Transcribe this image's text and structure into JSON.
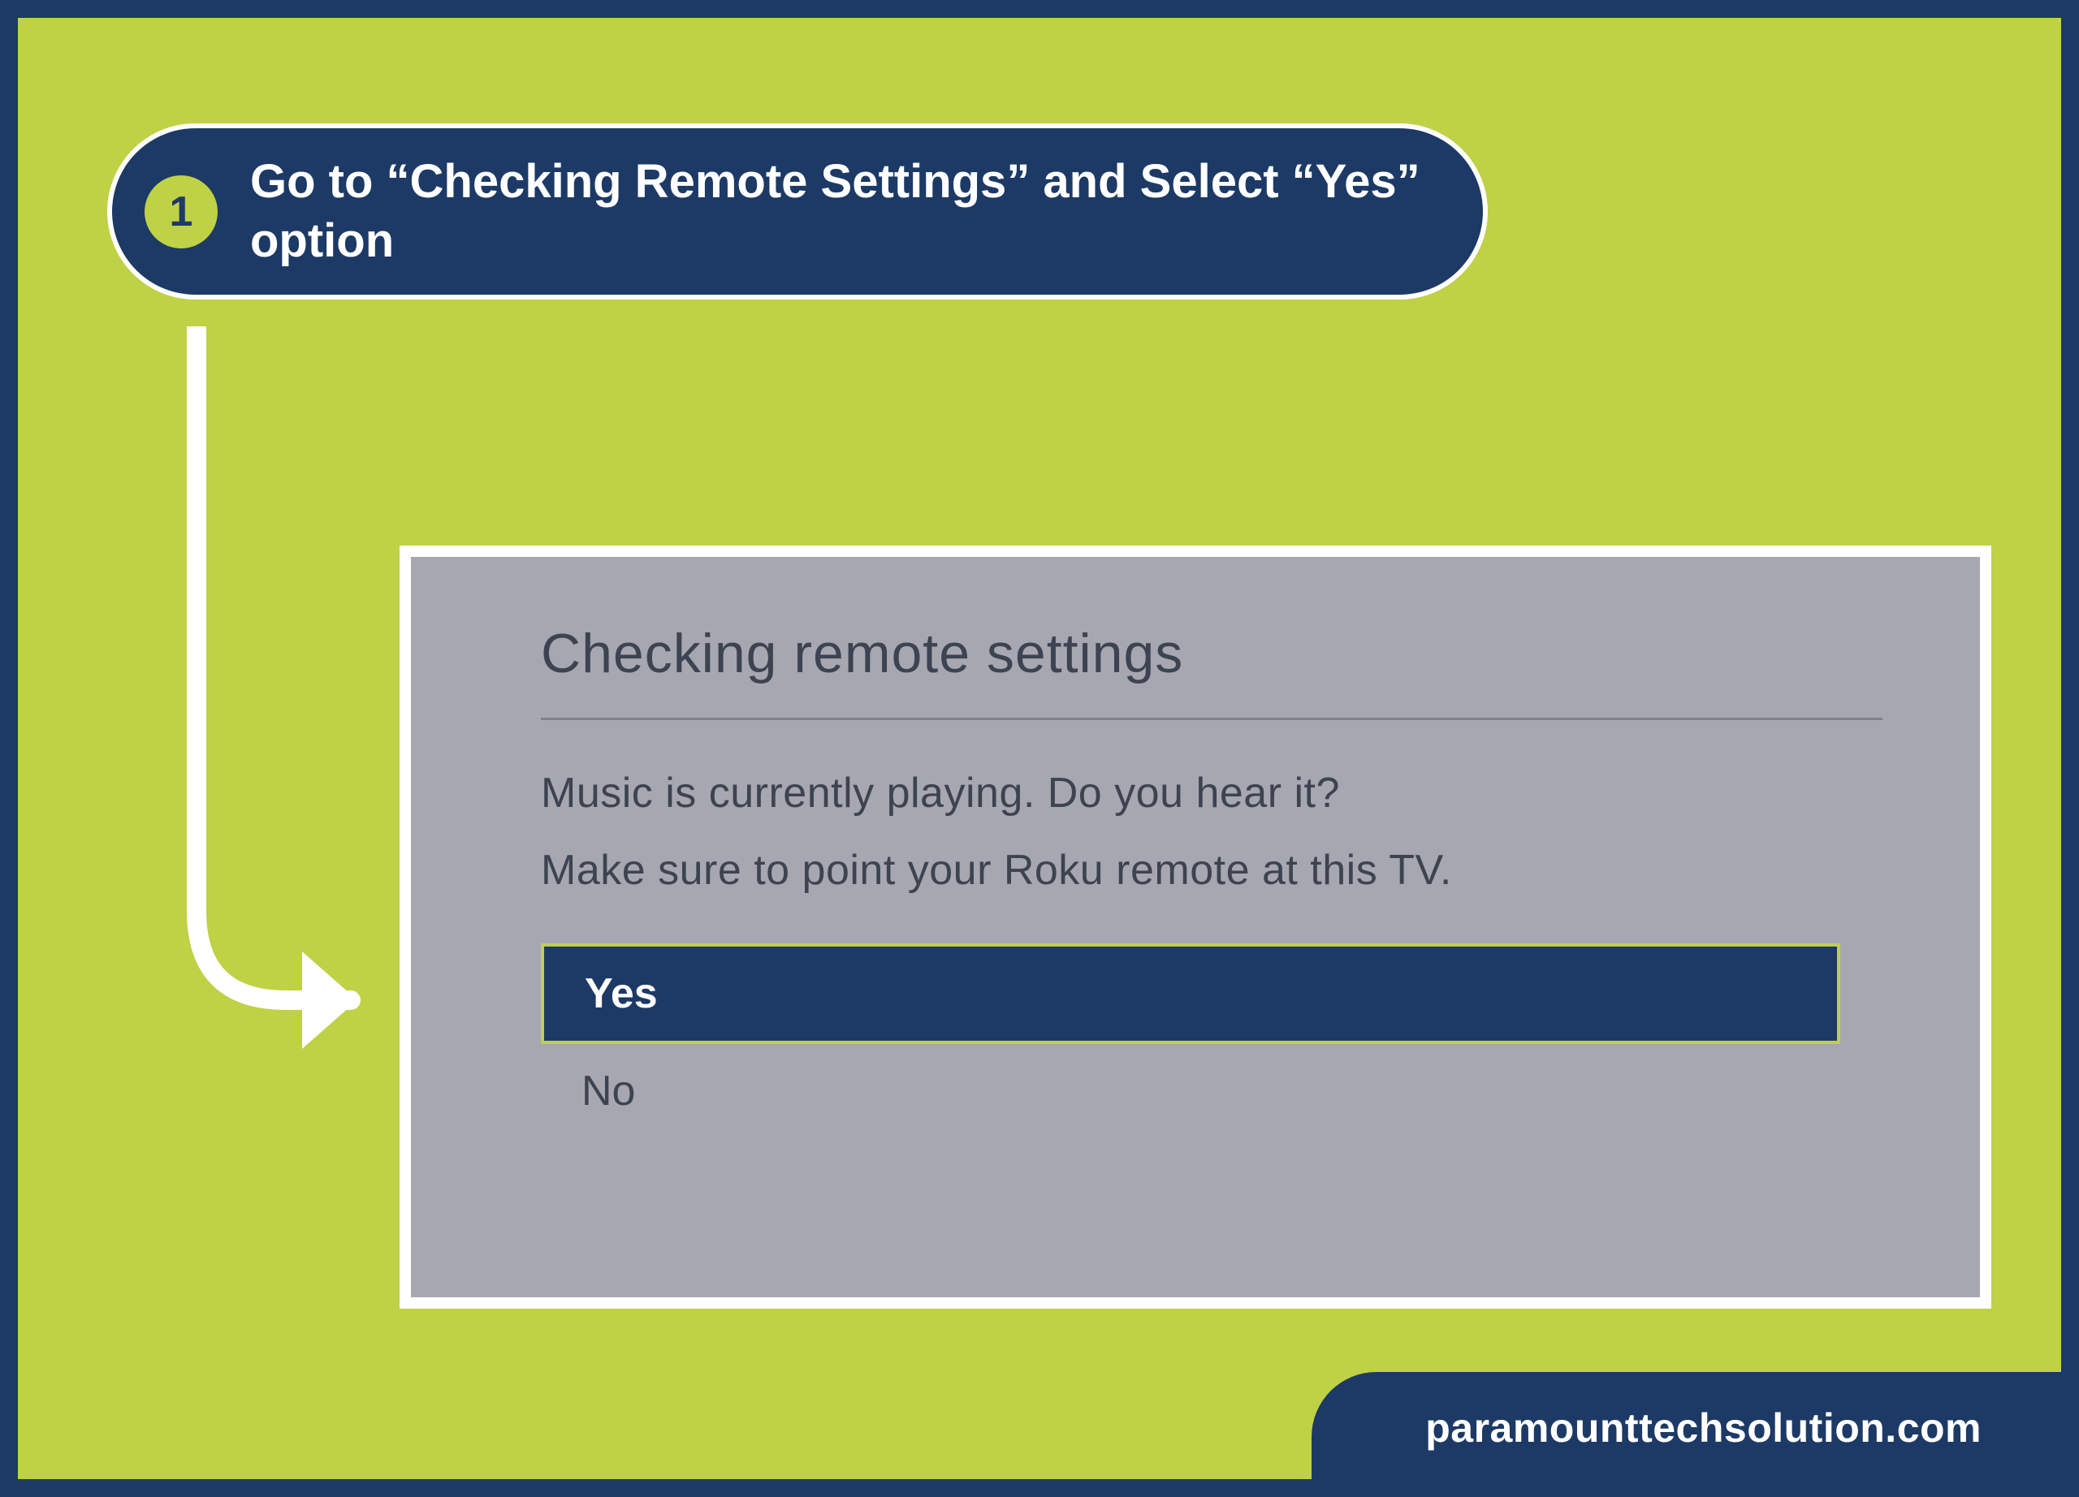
{
  "step": {
    "number": "1",
    "instruction": "Go to “Checking Remote Settings” and Select “Yes” option"
  },
  "dialog": {
    "title": "Checking remote settings",
    "line1": "Music is currently playing. Do you hear it?",
    "line2": "Make sure to point your Roku remote at this TV.",
    "options": {
      "yes": "Yes",
      "no": "No"
    }
  },
  "footer": {
    "site": "paramounttechsolution.com"
  },
  "colors": {
    "navy": "#1d3a66",
    "lime": "#bfd145",
    "gray": "#a7a7b1"
  }
}
